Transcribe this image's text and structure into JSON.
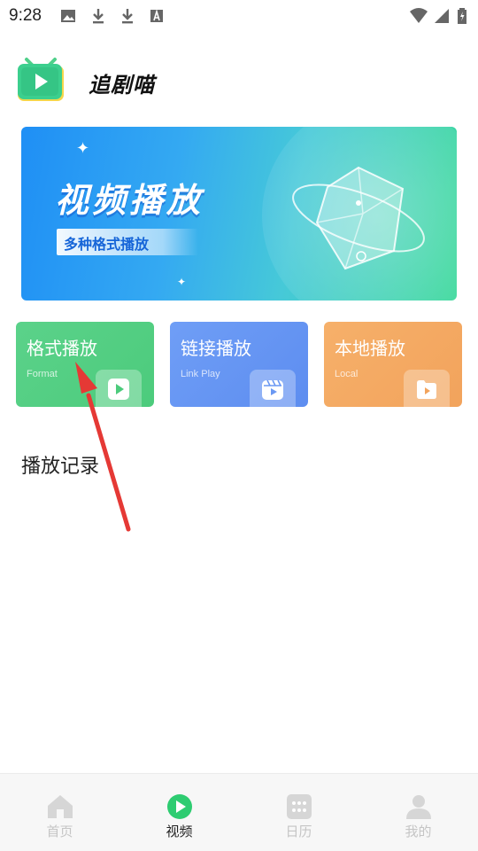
{
  "status_bar": {
    "time": "9:28"
  },
  "header": {
    "app_title": "追剧喵"
  },
  "banner": {
    "title": "视频播放",
    "tag": "多种格式播放"
  },
  "cards": [
    {
      "title": "格式播放",
      "subtitle": "Format",
      "color": "#55cf84",
      "icon": "play-square-icon"
    },
    {
      "title": "链接播放",
      "subtitle": "Link Play",
      "color": "#6896f3",
      "icon": "clapperboard-icon"
    },
    {
      "title": "本地播放",
      "subtitle": "Local",
      "color": "#f4aa63",
      "icon": "folder-play-icon"
    }
  ],
  "history": {
    "title": "播放记录"
  },
  "bottom_nav": [
    {
      "label": "首页",
      "icon": "home-icon",
      "active": false
    },
    {
      "label": "视频",
      "icon": "video-play-icon",
      "active": true
    },
    {
      "label": "日历",
      "icon": "calendar-grid-icon",
      "active": false
    },
    {
      "label": "我的",
      "icon": "user-icon",
      "active": false
    }
  ],
  "colors": {
    "accent": "#2ecc71",
    "arrow": "#e53935",
    "nav_inactive": "#c5c5c5"
  }
}
